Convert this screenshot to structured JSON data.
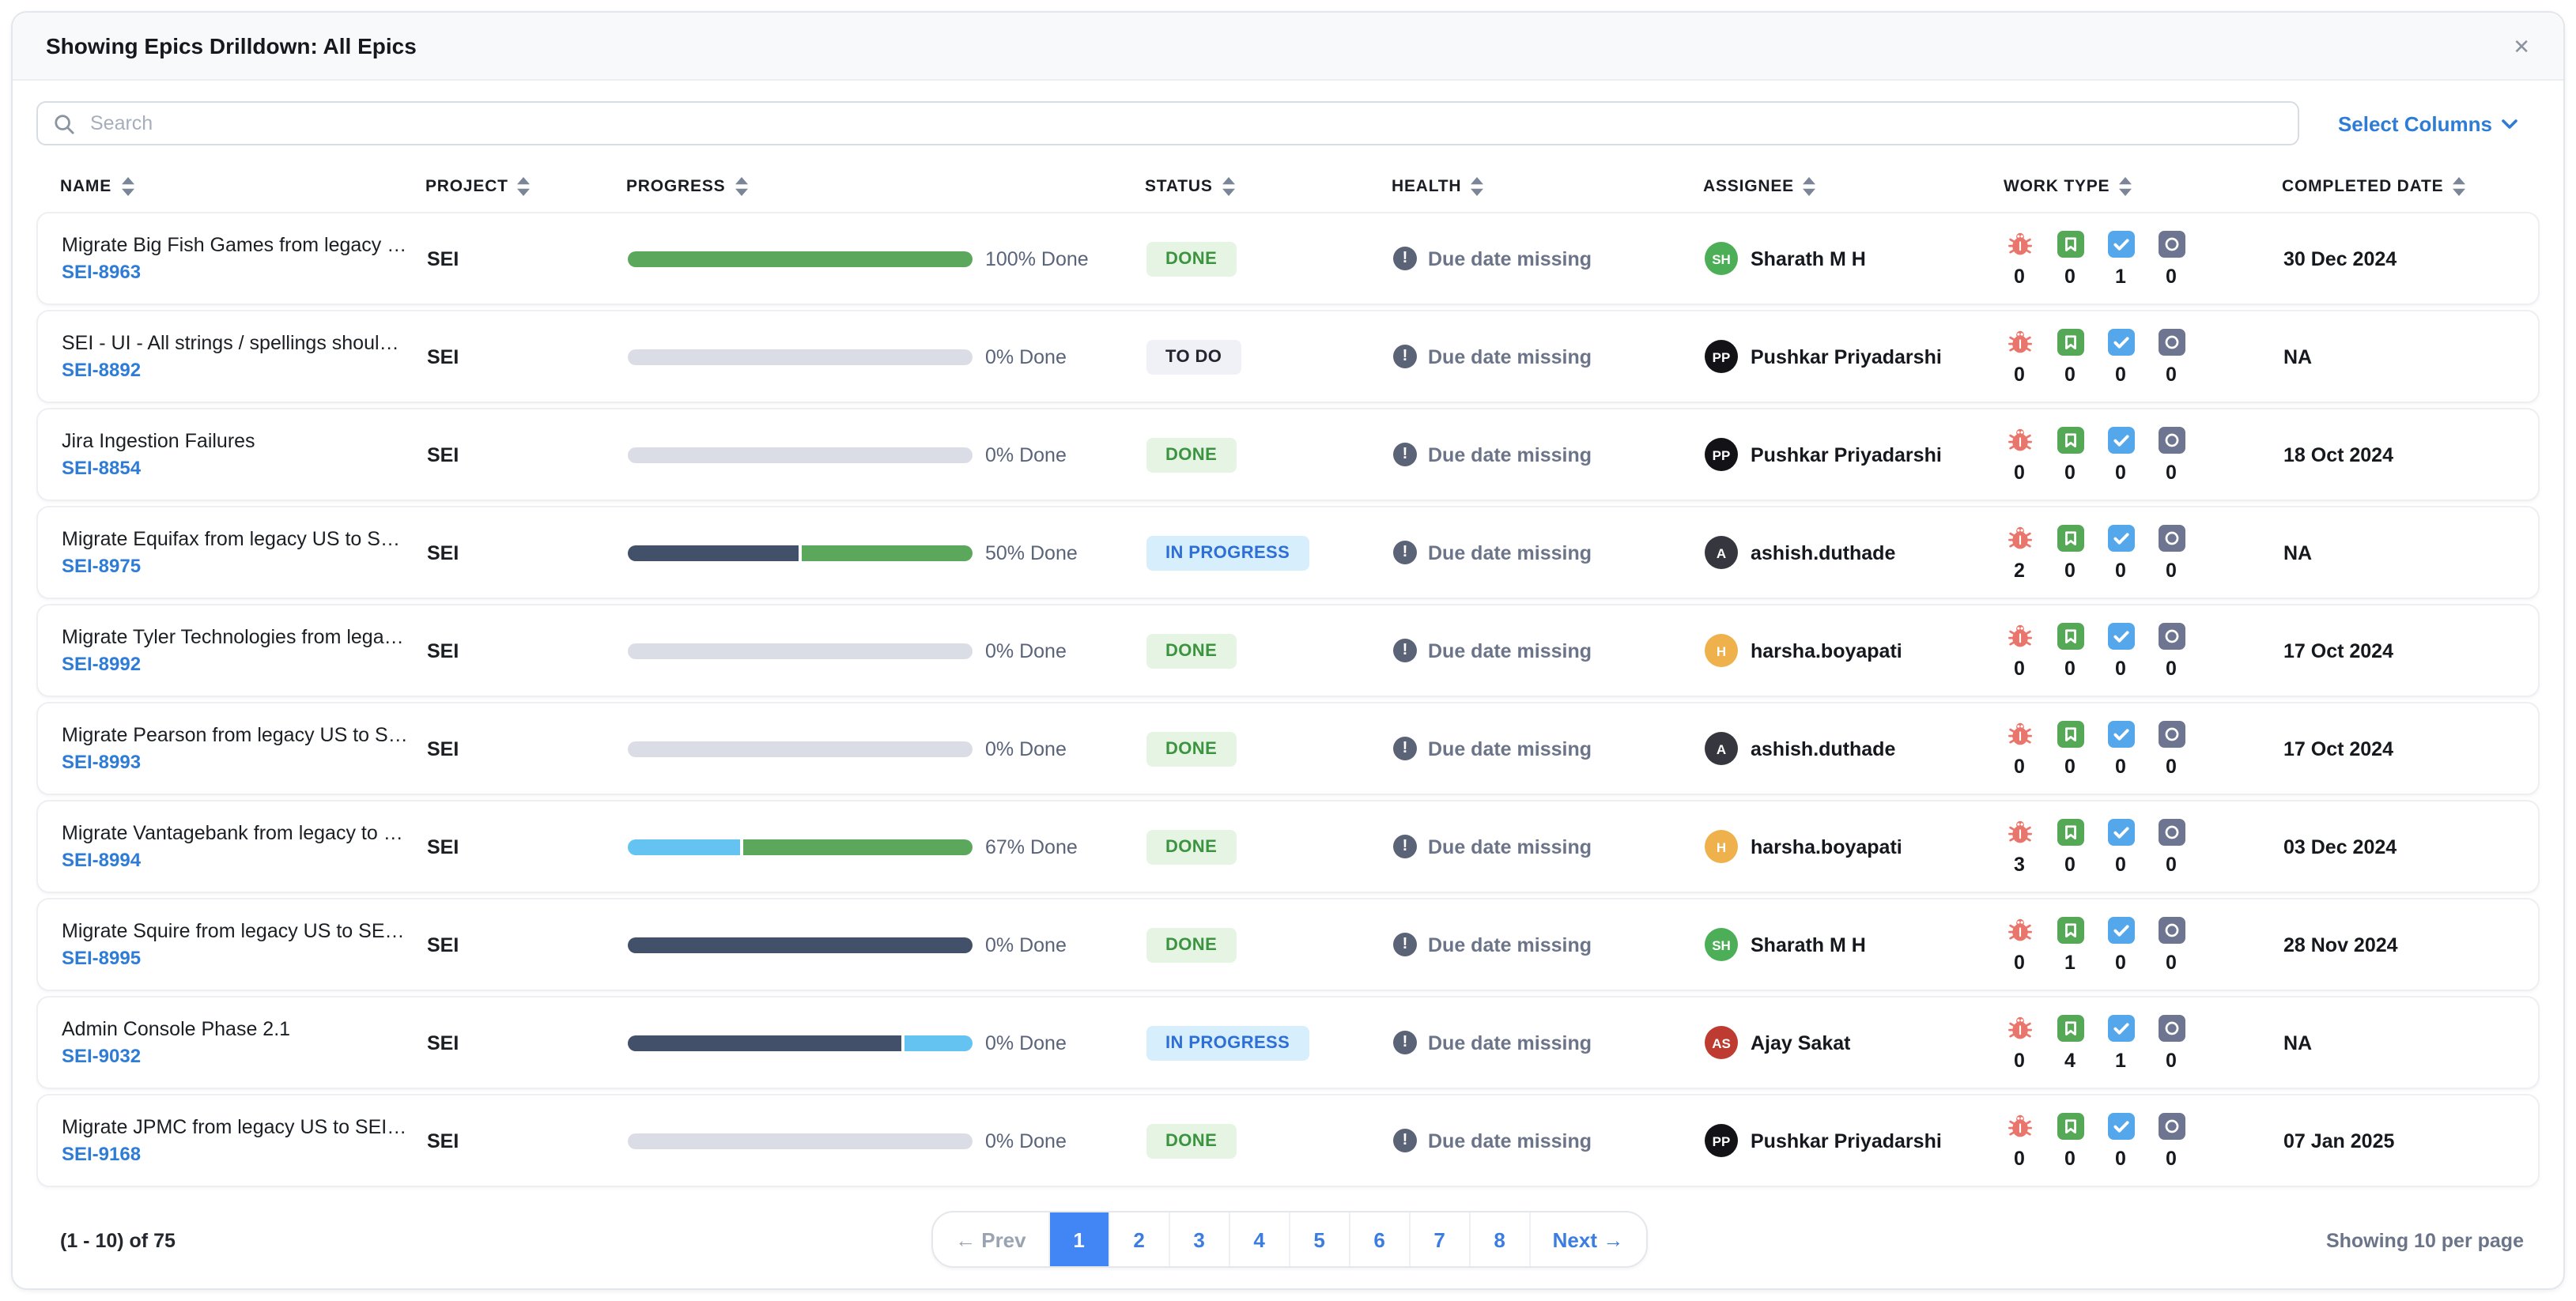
{
  "modal": {
    "title": "Showing Epics Drilldown: All Epics",
    "close_icon": "✕"
  },
  "toolbar": {
    "search_placeholder": "Search",
    "select_columns_label": "Select Columns"
  },
  "table": {
    "columns": [
      "Name",
      "Project",
      "Progress",
      "Status",
      "Health",
      "Assignee",
      "Work Type",
      "Completed Date"
    ],
    "work_type_icons": [
      "bug-icon",
      "story-icon",
      "task-icon",
      "epic-icon"
    ],
    "rows": [
      {
        "name": "Migrate Big Fish Games from legacy US to SEI ...",
        "id": "SEI-8963",
        "project": "SEI",
        "progress": {
          "label": "100% Done",
          "segments": [
            {
              "color": "green",
              "pct": 100
            }
          ]
        },
        "status": {
          "label": "DONE",
          "type": "done"
        },
        "health": "Due date missing",
        "assignee": {
          "initials": "SH",
          "name": "Sharath M H",
          "color": "green"
        },
        "work_type_counts": [
          "0",
          "0",
          "1",
          "0"
        ],
        "completed": "30 Dec 2024"
      },
      {
        "name": "SEI - UI - All strings / spellings should be in A...",
        "id": "SEI-8892",
        "project": "SEI",
        "progress": {
          "label": "0% Done",
          "segments": [
            {
              "color": "gray",
              "pct": 100
            }
          ]
        },
        "status": {
          "label": "TO DO",
          "type": "todo"
        },
        "health": "Due date missing",
        "assignee": {
          "initials": "PP",
          "name": "Pushkar Priyadarshi",
          "color": "black"
        },
        "work_type_counts": [
          "0",
          "0",
          "0",
          "0"
        ],
        "completed": "NA"
      },
      {
        "name": "Jira Ingestion Failures",
        "id": "SEI-8854",
        "project": "SEI",
        "progress": {
          "label": "0% Done",
          "segments": [
            {
              "color": "gray",
              "pct": 100
            }
          ]
        },
        "status": {
          "label": "DONE",
          "type": "done"
        },
        "health": "Due date missing",
        "assignee": {
          "initials": "PP",
          "name": "Pushkar Priyadarshi",
          "color": "black"
        },
        "work_type_counts": [
          "0",
          "0",
          "0",
          "0"
        ],
        "completed": "18 Oct 2024"
      },
      {
        "name": "Migrate Equifax from legacy US to SEI on Harn...",
        "id": "SEI-8975",
        "project": "SEI",
        "progress": {
          "label": "50% Done",
          "segments": [
            {
              "color": "slate",
              "pct": 50
            },
            {
              "color": "green",
              "pct": 50
            }
          ]
        },
        "status": {
          "label": "IN PROGRESS",
          "type": "inprogress"
        },
        "health": "Due date missing",
        "assignee": {
          "initials": "A",
          "name": "ashish.duthade",
          "color": "dark"
        },
        "work_type_counts": [
          "2",
          "0",
          "0",
          "0"
        ],
        "completed": "NA"
      },
      {
        "name": "Migrate Tyler Technologies from legacy US to ...",
        "id": "SEI-8992",
        "project": "SEI",
        "progress": {
          "label": "0% Done",
          "segments": [
            {
              "color": "gray",
              "pct": 100
            }
          ]
        },
        "status": {
          "label": "DONE",
          "type": "done"
        },
        "health": "Due date missing",
        "assignee": {
          "initials": "H",
          "name": "harsha.boyapati",
          "color": "amber"
        },
        "work_type_counts": [
          "0",
          "0",
          "0",
          "0"
        ],
        "completed": "17 Oct 2024"
      },
      {
        "name": "Migrate Pearson from legacy US to SEI on Har...",
        "id": "SEI-8993",
        "project": "SEI",
        "progress": {
          "label": "0% Done",
          "segments": [
            {
              "color": "gray",
              "pct": 100
            }
          ]
        },
        "status": {
          "label": "DONE",
          "type": "done"
        },
        "health": "Due date missing",
        "assignee": {
          "initials": "A",
          "name": "ashish.duthade",
          "color": "dark"
        },
        "work_type_counts": [
          "0",
          "0",
          "0",
          "0"
        ],
        "completed": "17 Oct 2024"
      },
      {
        "name": "Migrate Vantagebank from legacy to SEI on Ha...",
        "id": "SEI-8994",
        "project": "SEI",
        "progress": {
          "label": "67% Done",
          "segments": [
            {
              "color": "blue",
              "pct": 33
            },
            {
              "color": "green",
              "pct": 67
            }
          ]
        },
        "status": {
          "label": "DONE",
          "type": "done"
        },
        "health": "Due date missing",
        "assignee": {
          "initials": "H",
          "name": "harsha.boyapati",
          "color": "amber"
        },
        "work_type_counts": [
          "3",
          "0",
          "0",
          "0"
        ],
        "completed": "03 Dec 2024"
      },
      {
        "name": "Migrate Squire from legacy US to SEI on Harne...",
        "id": "SEI-8995",
        "project": "SEI",
        "progress": {
          "label": "0% Done",
          "segments": [
            {
              "color": "slate",
              "pct": 100
            }
          ]
        },
        "status": {
          "label": "DONE",
          "type": "done"
        },
        "health": "Due date missing",
        "assignee": {
          "initials": "SH",
          "name": "Sharath M H",
          "color": "green"
        },
        "work_type_counts": [
          "0",
          "1",
          "0",
          "0"
        ],
        "completed": "28 Nov 2024"
      },
      {
        "name": "Admin Console Phase 2.1",
        "id": "SEI-9032",
        "project": "SEI",
        "progress": {
          "label": "0% Done",
          "segments": [
            {
              "color": "slate",
              "pct": 80
            },
            {
              "color": "blue",
              "pct": 20
            }
          ]
        },
        "status": {
          "label": "IN PROGRESS",
          "type": "inprogress"
        },
        "health": "Due date missing",
        "assignee": {
          "initials": "AS",
          "name": "Ajay Sakat",
          "color": "red"
        },
        "work_type_counts": [
          "0",
          "4",
          "1",
          "0"
        ],
        "completed": "NA"
      },
      {
        "name": "Migrate JPMC from legacy US to SEI on Harne...",
        "id": "SEI-9168",
        "project": "SEI",
        "progress": {
          "label": "0% Done",
          "segments": [
            {
              "color": "gray",
              "pct": 100
            }
          ]
        },
        "status": {
          "label": "DONE",
          "type": "done"
        },
        "health": "Due date missing",
        "assignee": {
          "initials": "PP",
          "name": "Pushkar Priyadarshi",
          "color": "black"
        },
        "work_type_counts": [
          "0",
          "0",
          "0",
          "0"
        ],
        "completed": "07 Jan 2025"
      }
    ]
  },
  "footer": {
    "range_label": "(1 - 10) of 75",
    "prev_label": "Prev",
    "prev_arrow": "←",
    "pages": [
      "1",
      "2",
      "3",
      "4",
      "5",
      "6",
      "7",
      "8"
    ],
    "active_page": "1",
    "next_label": "Next",
    "next_arrow": "→",
    "per_page_label": "Showing 10 per page"
  },
  "colors": {
    "progress": {
      "green": "#5BA85C",
      "gray": "#DBDDE6",
      "slate": "#42506A",
      "blue": "#64C3F0"
    },
    "avatar": {
      "green": "#4CAF57",
      "black": "#121217",
      "dark": "#35363E",
      "amber": "#EFB14C",
      "red": "#BE3B31"
    },
    "accent_blue": "#4285F4"
  }
}
